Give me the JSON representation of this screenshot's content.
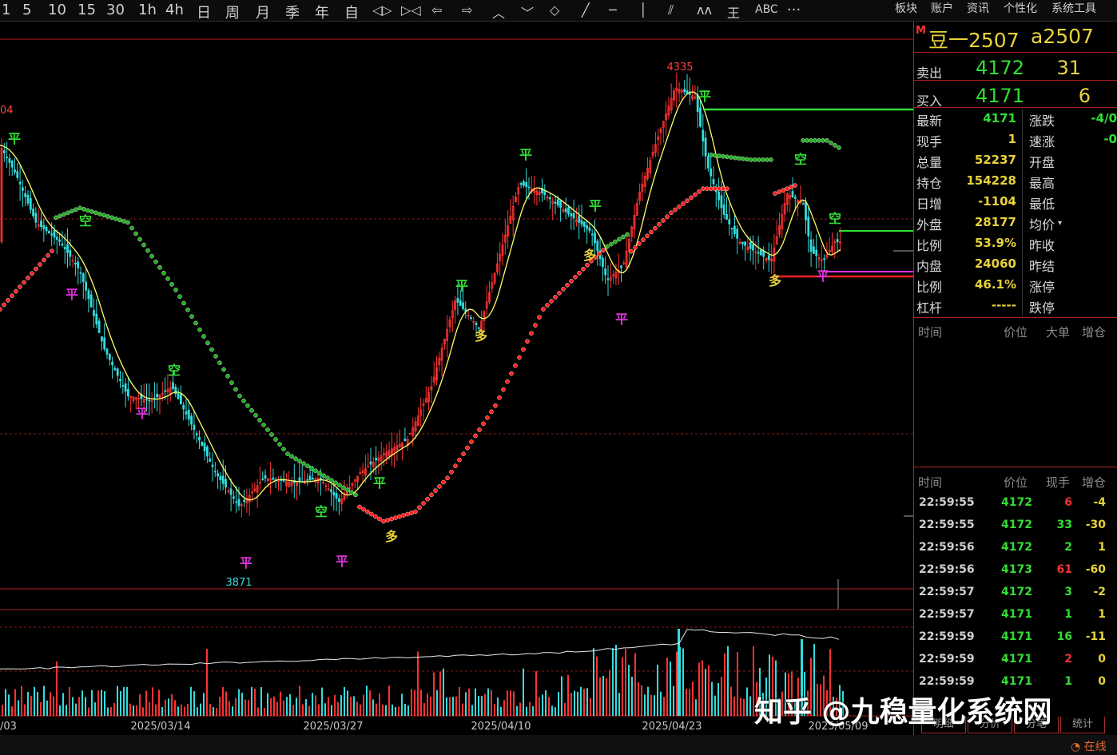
{
  "toolbar": {
    "periods": [
      "1",
      "5",
      "10",
      "15",
      "30",
      "1h",
      "4h",
      "日",
      "周",
      "月",
      "季",
      "年",
      "自"
    ],
    "tool_icons": [
      "zoom-icon",
      "fit-icon",
      "arrow-left-icon",
      "arrow-right-icon",
      "chevron-up-icon",
      "chevron-down-icon",
      "crosshair-icon",
      "line-icon",
      "hline-icon",
      "vline-icon",
      "channel-icon",
      "wave-icon",
      "fib-icon"
    ],
    "abc": "ABC",
    "more": "···",
    "menu": [
      "板块",
      "账户",
      "资讯",
      "个性化",
      "系统工具"
    ]
  },
  "quote": {
    "marker": "M",
    "name": "豆一2507",
    "code": "a2507",
    "sell_label": "卖出",
    "sell_price": "4172",
    "sell_qty": "31",
    "buy_label": "买入",
    "buy_price": "4171",
    "buy_qty": "6",
    "stats": [
      {
        "label": "最新",
        "value": "4171",
        "color": "#33dd33"
      },
      {
        "label": "现手",
        "value": "1",
        "color": "#e8d23a"
      },
      {
        "label": "总量",
        "value": "52237",
        "color": "#e8d23a"
      },
      {
        "label": "持仓",
        "value": "154228",
        "color": "#e8d23a"
      },
      {
        "label": "日增",
        "value": "-1104",
        "color": "#e8d23a"
      },
      {
        "label": "外盘",
        "value": "28177",
        "color": "#e8d23a"
      },
      {
        "label": "比例",
        "value": "53.9%",
        "color": "#e8d23a"
      },
      {
        "label": "内盘",
        "value": "24060",
        "color": "#e8d23a"
      },
      {
        "label": "比例",
        "value": "46.1%",
        "color": "#e8d23a"
      },
      {
        "label": "杠杆",
        "value": "-----",
        "color": "#e8d23a"
      }
    ],
    "stats_right": [
      {
        "label": "涨跌",
        "value": "-4/0",
        "color": "#33dd33"
      },
      {
        "label": "速涨",
        "value": "-0",
        "color": "#33dd33"
      },
      {
        "label": "开盘",
        "value": ""
      },
      {
        "label": "最高",
        "value": ""
      },
      {
        "label": "最低",
        "value": ""
      },
      {
        "label": "均价",
        "value": ""
      },
      {
        "label": "昨收",
        "value": ""
      },
      {
        "label": "昨结",
        "value": ""
      },
      {
        "label": "涨停",
        "value": ""
      },
      {
        "label": "跌停",
        "value": ""
      }
    ]
  },
  "big_orders_header": [
    "时间",
    "价位",
    "大单",
    "增仓"
  ],
  "ticks_header": [
    "时间",
    "价位",
    "现手",
    "增仓"
  ],
  "ticks": [
    {
      "time": "22:59:55",
      "price": "4172",
      "qty": "6",
      "oi": "-4",
      "qc": "#ee3333",
      "oc": "#e8d23a"
    },
    {
      "time": "22:59:55",
      "price": "4172",
      "qty": "33",
      "oi": "-30",
      "qc": "#33dd33",
      "oc": "#e8d23a"
    },
    {
      "time": "22:59:56",
      "price": "4172",
      "qty": "2",
      "oi": "1",
      "qc": "#33dd33",
      "oc": "#e8d23a"
    },
    {
      "time": "22:59:56",
      "price": "4173",
      "qty": "61",
      "oi": "-60",
      "qc": "#ee3333",
      "oc": "#e8d23a"
    },
    {
      "time": "22:59:57",
      "price": "4172",
      "qty": "3",
      "oi": "-2",
      "qc": "#33dd33",
      "oc": "#e8d23a"
    },
    {
      "time": "22:59:57",
      "price": "4171",
      "qty": "1",
      "oi": "1",
      "qc": "#33dd33",
      "oc": "#e8d23a"
    },
    {
      "time": "22:59:59",
      "price": "4171",
      "qty": "16",
      "oi": "-11",
      "qc": "#33dd33",
      "oc": "#e8d23a"
    },
    {
      "time": "22:59:59",
      "price": "4171",
      "qty": "2",
      "oi": "0",
      "qc": "#ee3333",
      "oc": "#e8d23a"
    },
    {
      "time": "22:59:59",
      "price": "4171",
      "qty": "1",
      "oi": "0",
      "qc": "#33dd33",
      "oc": "#e8d23a"
    }
  ],
  "bottom_tabs": [
    "明细",
    "分价",
    "分笔",
    "统计"
  ],
  "status_text": "在线",
  "watermark": "知乎 @九稳量化系统网",
  "chart_labels": {
    "high": "4335",
    "low": "3871",
    "left_cut": "04",
    "dates": [
      "/03",
      "2025/03/14",
      "2025/03/27",
      "2025/04/10",
      "2025/04/23",
      "2025/05/09"
    ]
  },
  "signals": [
    {
      "t": "平",
      "c": "#33dd33"
    },
    {
      "t": "空",
      "c": "#33dd33"
    },
    {
      "t": "平",
      "c": "#dd33dd"
    },
    {
      "t": "平",
      "c": "#dd33dd"
    },
    {
      "t": "空",
      "c": "#33dd33"
    },
    {
      "t": "空",
      "c": "#33dd33"
    },
    {
      "t": "平",
      "c": "#dd33dd"
    },
    {
      "t": "平",
      "c": "#dd33dd"
    },
    {
      "t": "平",
      "c": "#33dd33"
    },
    {
      "t": "多",
      "c": "#e8d23a"
    },
    {
      "t": "平",
      "c": "#33dd33"
    },
    {
      "t": "多",
      "c": "#e8d23a"
    },
    {
      "t": "平",
      "c": "#33dd33"
    },
    {
      "t": "平",
      "c": "#33dd33"
    },
    {
      "t": "多",
      "c": "#e8d23a"
    },
    {
      "t": "平",
      "c": "#dd33dd"
    },
    {
      "t": "平",
      "c": "#33dd33"
    },
    {
      "t": "空",
      "c": "#33dd33"
    },
    {
      "t": "多",
      "c": "#e8d23a"
    },
    {
      "t": "空",
      "c": "#33dd33"
    },
    {
      "t": "平",
      "c": "#dd33dd"
    }
  ]
}
